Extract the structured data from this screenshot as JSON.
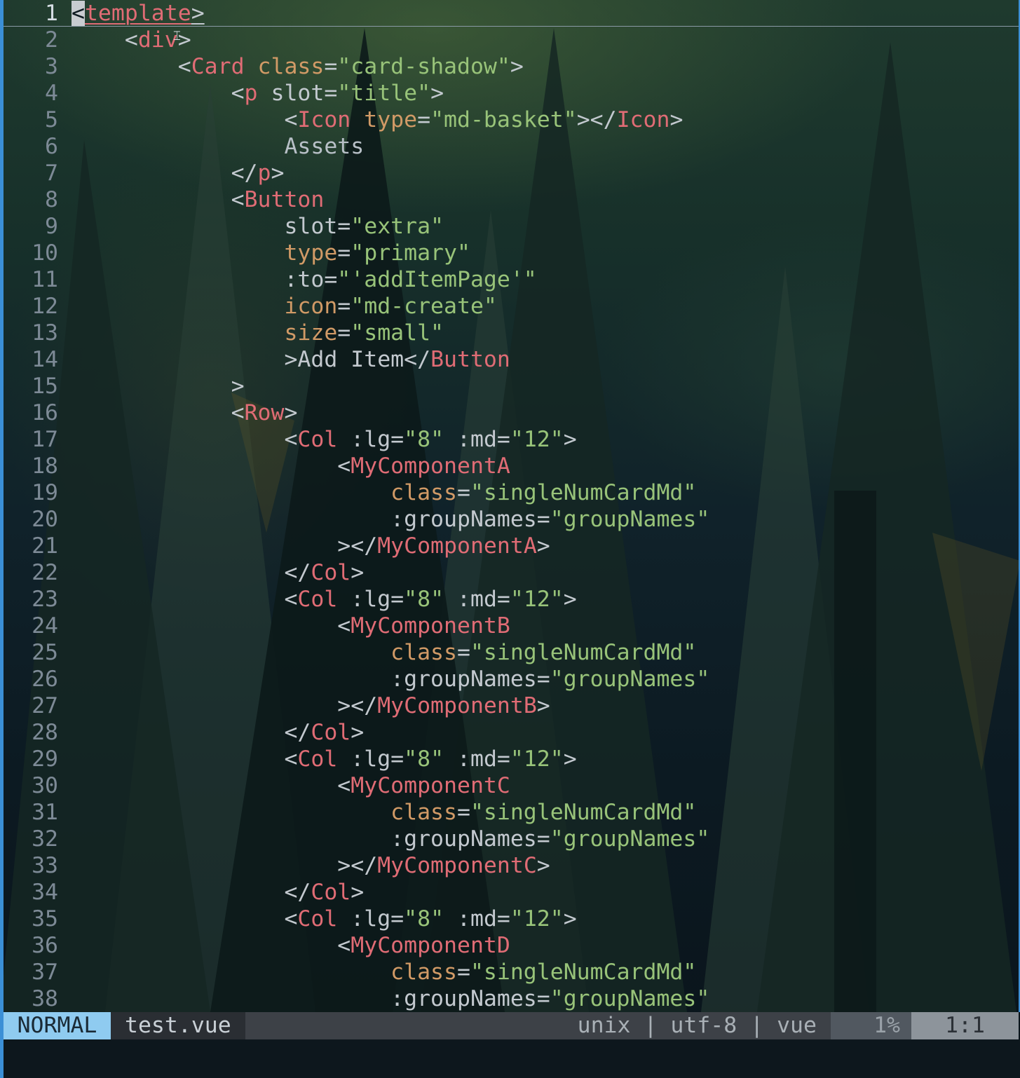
{
  "editor": {
    "lines": [
      {
        "n": "1",
        "indent": "",
        "segments": [
          {
            "c": "cursor",
            "t": "<"
          },
          {
            "c": "tag ul",
            "t": "template"
          },
          {
            "c": "ul",
            "t": ">"
          }
        ]
      },
      {
        "n": "2",
        "indent": "    ",
        "segments": [
          {
            "c": "",
            "t": "<"
          },
          {
            "c": "tag",
            "t": "div"
          },
          {
            "c": "",
            "t": ">"
          }
        ]
      },
      {
        "n": "3",
        "indent": "        ",
        "segments": [
          {
            "c": "",
            "t": "<"
          },
          {
            "c": "tag",
            "t": "Card"
          },
          {
            "c": "",
            "t": " "
          },
          {
            "c": "attr",
            "t": "class"
          },
          {
            "c": "",
            "t": "="
          },
          {
            "c": "str",
            "t": "\"card-shadow\""
          },
          {
            "c": "",
            "t": ">"
          }
        ]
      },
      {
        "n": "4",
        "indent": "            ",
        "segments": [
          {
            "c": "",
            "t": "<"
          },
          {
            "c": "tag",
            "t": "p"
          },
          {
            "c": "",
            "t": " slot="
          },
          {
            "c": "str",
            "t": "\"title\""
          },
          {
            "c": "",
            "t": ">"
          }
        ]
      },
      {
        "n": "5",
        "indent": "                ",
        "segments": [
          {
            "c": "",
            "t": "<"
          },
          {
            "c": "tag",
            "t": "Icon"
          },
          {
            "c": "",
            "t": " "
          },
          {
            "c": "attr",
            "t": "type"
          },
          {
            "c": "",
            "t": "="
          },
          {
            "c": "str",
            "t": "\"md-basket\""
          },
          {
            "c": "",
            "t": "></"
          },
          {
            "c": "tag",
            "t": "Icon"
          },
          {
            "c": "",
            "t": ">"
          }
        ]
      },
      {
        "n": "6",
        "indent": "                ",
        "segments": [
          {
            "c": "txt",
            "t": "Assets"
          }
        ]
      },
      {
        "n": "7",
        "indent": "            ",
        "segments": [
          {
            "c": "",
            "t": "</"
          },
          {
            "c": "tag",
            "t": "p"
          },
          {
            "c": "",
            "t": ">"
          }
        ]
      },
      {
        "n": "8",
        "indent": "            ",
        "segments": [
          {
            "c": "",
            "t": "<"
          },
          {
            "c": "tag",
            "t": "Button"
          }
        ]
      },
      {
        "n": "9",
        "indent": "                ",
        "segments": [
          {
            "c": "",
            "t": "slot="
          },
          {
            "c": "str",
            "t": "\"extra\""
          }
        ]
      },
      {
        "n": "10",
        "indent": "                ",
        "segments": [
          {
            "c": "attr",
            "t": "type"
          },
          {
            "c": "",
            "t": "="
          },
          {
            "c": "str",
            "t": "\"primary\""
          }
        ]
      },
      {
        "n": "11",
        "indent": "                ",
        "segments": [
          {
            "c": "",
            "t": ":to="
          },
          {
            "c": "str",
            "t": "\"'addItemPage'\""
          }
        ]
      },
      {
        "n": "12",
        "indent": "                ",
        "segments": [
          {
            "c": "attr",
            "t": "icon"
          },
          {
            "c": "",
            "t": "="
          },
          {
            "c": "str",
            "t": "\"md-create\""
          }
        ]
      },
      {
        "n": "13",
        "indent": "                ",
        "segments": [
          {
            "c": "attr",
            "t": "size"
          },
          {
            "c": "",
            "t": "="
          },
          {
            "c": "str",
            "t": "\"small\""
          }
        ]
      },
      {
        "n": "14",
        "indent": "                ",
        "segments": [
          {
            "c": "",
            "t": ">Add Item</"
          },
          {
            "c": "tag",
            "t": "Button"
          }
        ]
      },
      {
        "n": "15",
        "indent": "            ",
        "segments": [
          {
            "c": "",
            "t": ">"
          }
        ]
      },
      {
        "n": "16",
        "indent": "            ",
        "segments": [
          {
            "c": "",
            "t": "<"
          },
          {
            "c": "tag",
            "t": "Row"
          },
          {
            "c": "",
            "t": ">"
          }
        ]
      },
      {
        "n": "17",
        "indent": "                ",
        "segments": [
          {
            "c": "",
            "t": "<"
          },
          {
            "c": "tag",
            "t": "Col"
          },
          {
            "c": "",
            "t": " :lg="
          },
          {
            "c": "str",
            "t": "\"8\""
          },
          {
            "c": "",
            "t": " :md="
          },
          {
            "c": "str",
            "t": "\"12\""
          },
          {
            "c": "",
            "t": ">"
          }
        ]
      },
      {
        "n": "18",
        "indent": "                    ",
        "segments": [
          {
            "c": "",
            "t": "<"
          },
          {
            "c": "tag",
            "t": "MyComponentA"
          }
        ]
      },
      {
        "n": "19",
        "indent": "                        ",
        "segments": [
          {
            "c": "attr",
            "t": "class"
          },
          {
            "c": "",
            "t": "="
          },
          {
            "c": "str",
            "t": "\"singleNumCardMd\""
          }
        ]
      },
      {
        "n": "20",
        "indent": "                        ",
        "segments": [
          {
            "c": "",
            "t": ":groupNames="
          },
          {
            "c": "str",
            "t": "\"groupNames\""
          }
        ]
      },
      {
        "n": "21",
        "indent": "                    ",
        "segments": [
          {
            "c": "",
            "t": "></"
          },
          {
            "c": "tag",
            "t": "MyComponentA"
          },
          {
            "c": "",
            "t": ">"
          }
        ]
      },
      {
        "n": "22",
        "indent": "                ",
        "segments": [
          {
            "c": "",
            "t": "</"
          },
          {
            "c": "tag",
            "t": "Col"
          },
          {
            "c": "",
            "t": ">"
          }
        ]
      },
      {
        "n": "23",
        "indent": "                ",
        "segments": [
          {
            "c": "",
            "t": "<"
          },
          {
            "c": "tag",
            "t": "Col"
          },
          {
            "c": "",
            "t": " :lg="
          },
          {
            "c": "str",
            "t": "\"8\""
          },
          {
            "c": "",
            "t": " :md="
          },
          {
            "c": "str",
            "t": "\"12\""
          },
          {
            "c": "",
            "t": ">"
          }
        ]
      },
      {
        "n": "24",
        "indent": "                    ",
        "segments": [
          {
            "c": "",
            "t": "<"
          },
          {
            "c": "tag",
            "t": "MyComponentB"
          }
        ]
      },
      {
        "n": "25",
        "indent": "                        ",
        "segments": [
          {
            "c": "attr",
            "t": "class"
          },
          {
            "c": "",
            "t": "="
          },
          {
            "c": "str",
            "t": "\"singleNumCardMd\""
          }
        ]
      },
      {
        "n": "26",
        "indent": "                        ",
        "segments": [
          {
            "c": "",
            "t": ":groupNames="
          },
          {
            "c": "str",
            "t": "\"groupNames\""
          }
        ]
      },
      {
        "n": "27",
        "indent": "                    ",
        "segments": [
          {
            "c": "",
            "t": "></"
          },
          {
            "c": "tag",
            "t": "MyComponentB"
          },
          {
            "c": "",
            "t": ">"
          }
        ]
      },
      {
        "n": "28",
        "indent": "                ",
        "segments": [
          {
            "c": "",
            "t": "</"
          },
          {
            "c": "tag",
            "t": "Col"
          },
          {
            "c": "",
            "t": ">"
          }
        ]
      },
      {
        "n": "29",
        "indent": "                ",
        "segments": [
          {
            "c": "",
            "t": "<"
          },
          {
            "c": "tag",
            "t": "Col"
          },
          {
            "c": "",
            "t": " :lg="
          },
          {
            "c": "str",
            "t": "\"8\""
          },
          {
            "c": "",
            "t": " :md="
          },
          {
            "c": "str",
            "t": "\"12\""
          },
          {
            "c": "",
            "t": ">"
          }
        ]
      },
      {
        "n": "30",
        "indent": "                    ",
        "segments": [
          {
            "c": "",
            "t": "<"
          },
          {
            "c": "tag",
            "t": "MyComponentC"
          }
        ]
      },
      {
        "n": "31",
        "indent": "                        ",
        "segments": [
          {
            "c": "attr",
            "t": "class"
          },
          {
            "c": "",
            "t": "="
          },
          {
            "c": "str",
            "t": "\"singleNumCardMd\""
          }
        ]
      },
      {
        "n": "32",
        "indent": "                        ",
        "segments": [
          {
            "c": "",
            "t": ":groupNames="
          },
          {
            "c": "str",
            "t": "\"groupNames\""
          }
        ]
      },
      {
        "n": "33",
        "indent": "                    ",
        "segments": [
          {
            "c": "",
            "t": "></"
          },
          {
            "c": "tag",
            "t": "MyComponentC"
          },
          {
            "c": "",
            "t": ">"
          }
        ]
      },
      {
        "n": "34",
        "indent": "                ",
        "segments": [
          {
            "c": "",
            "t": "</"
          },
          {
            "c": "tag",
            "t": "Col"
          },
          {
            "c": "",
            "t": ">"
          }
        ]
      },
      {
        "n": "35",
        "indent": "                ",
        "segments": [
          {
            "c": "",
            "t": "<"
          },
          {
            "c": "tag",
            "t": "Col"
          },
          {
            "c": "",
            "t": " :lg="
          },
          {
            "c": "str",
            "t": "\"8\""
          },
          {
            "c": "",
            "t": " :md="
          },
          {
            "c": "str",
            "t": "\"12\""
          },
          {
            "c": "",
            "t": ">"
          }
        ]
      },
      {
        "n": "36",
        "indent": "                    ",
        "segments": [
          {
            "c": "",
            "t": "<"
          },
          {
            "c": "tag",
            "t": "MyComponentD"
          }
        ]
      },
      {
        "n": "37",
        "indent": "                        ",
        "segments": [
          {
            "c": "attr",
            "t": "class"
          },
          {
            "c": "",
            "t": "="
          },
          {
            "c": "str",
            "t": "\"singleNumCardMd\""
          }
        ]
      },
      {
        "n": "38",
        "indent": "                        ",
        "segments": [
          {
            "c": "",
            "t": ":groupNames="
          },
          {
            "c": "str",
            "t": "\"groupNames\""
          }
        ]
      }
    ]
  },
  "statusline": {
    "mode": "NORMAL",
    "filename": "test.vue",
    "fileinfo": "unix | utf-8 | vue",
    "percent": "1%",
    "position": "1:1"
  },
  "colors": {
    "mode_bg": "#8fcbf0",
    "tag": "#e06c75",
    "attribute": "#d19a66",
    "string": "#98c379",
    "border": "#3b8fd6"
  },
  "icons": {
    "mouse_cursor": "ibeam-cursor-icon"
  }
}
